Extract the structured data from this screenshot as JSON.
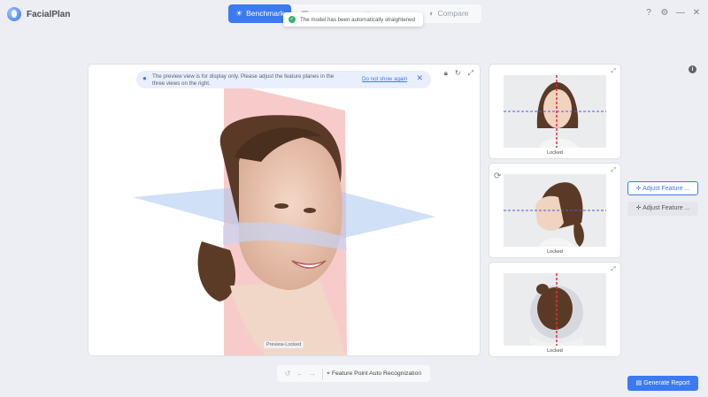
{
  "app": {
    "name": "FacialPlan"
  },
  "tabs": [
    {
      "label": "Benchmark",
      "active": true
    },
    {
      "label": ""
    },
    {
      "label": ""
    },
    {
      "label": "Compare"
    }
  ],
  "toast": {
    "text": "The model has been automatically straightened"
  },
  "window_controls": [
    "?",
    "⚙",
    "—",
    "✕"
  ],
  "viewport": {
    "notice": "The preview view is for display only. Please adjust the feature planes in the three views on the right.",
    "notice_link": "Do not show again",
    "label": "Preview-Locked"
  },
  "side_views": [
    {
      "status": "Locked"
    },
    {
      "status": "Locked"
    },
    {
      "status": "Locked"
    }
  ],
  "buttons": {
    "adjust1": "Adjust Feature ...",
    "adjust2": "Adjust Feature ...",
    "generate": "Generate Report"
  },
  "toolbar": {
    "auto_recognition": "Feature Point Auto Recognization"
  },
  "colors": {
    "accent": "#3b7af2",
    "success": "#2fb36b",
    "plane_red": "#f2a0a0",
    "plane_blue": "#a9c6ee"
  }
}
